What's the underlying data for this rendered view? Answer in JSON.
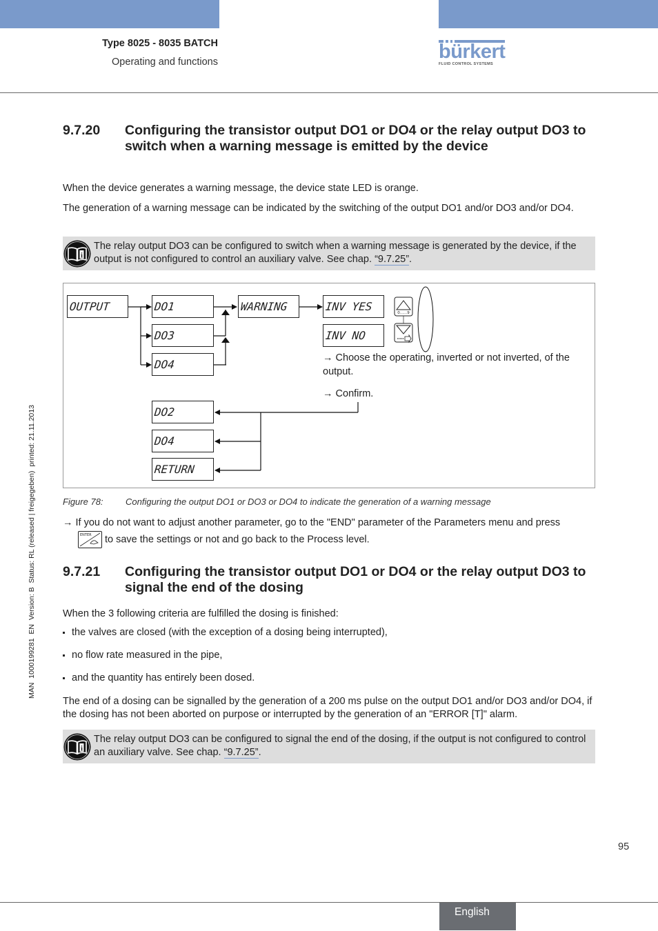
{
  "header": {
    "title": "Type 8025 - 8035 BATCH",
    "subtitle": "Operating and functions",
    "logo": {
      "name": "bürkert",
      "tagline": "FLUID CONTROL SYSTEMS"
    },
    "accent_color": "#7a9acb"
  },
  "sidebar_meta": "MAN  1000199281  EN  Version: B  Status: RL (released | freigegeben)  printed: 21.11.2013",
  "section_9_7_20": {
    "number": "9.7.20",
    "title": "Configuring the transistor output DO1 or DO4 or the relay output DO3 to switch when a warning message is emitted by the device",
    "para1": "When the device generates a warning message, the device state LED is orange.",
    "para2": "The generation of a warning message can be indicated by the switching of the output DO1 and/or DO3 and/or DO4.",
    "note": {
      "icon": "info-book-icon",
      "text_before": "The relay output DO3 can be configured to switch when a warning message is generated by the device, if the output is not configured to control an auxiliary valve. See chap. ",
      "link": "“9.7.25”",
      "text_after": "."
    },
    "figure": {
      "boxes": {
        "output": "OUTPUT",
        "do1": "DO1",
        "do3": "DO3",
        "do4": "DO4",
        "warning": "WARNING",
        "inv_yes": "INV YES",
        "inv_no": "INV NO",
        "do2_back": "DO2",
        "do4_back": "DO4",
        "return": "RETURN"
      },
      "key_up_label": "0......9",
      "note_choose": "→ Choose the operating, inverted or not inverted, of the output.",
      "note_confirm": "→ Confirm."
    },
    "caption": {
      "label": "Figure 78:",
      "text": "Configuring the output DO1 or DO3 or DO4 to indicate the generation of a warning message"
    },
    "instruction": {
      "text_before": "→ If you do not want to adjust another parameter, go to the \"END\" parameter of the Parameters menu and press",
      "key_label": "ENTER",
      "text_after": "to save the settings or not and go back to the Process level."
    }
  },
  "section_9_7_21": {
    "number": "9.7.21",
    "title": "Configuring the transistor output DO1 or DO4 or the relay output DO3 to signal the end of the dosing",
    "intro": "When the 3 following criteria are fulfilled the dosing is finished:",
    "bullets": [
      "the valves are closed (with the exception of a dosing being interrupted),",
      "no flow rate measured in the pipe,",
      "and the quantity has entirely been dosed."
    ],
    "para": "The end of a dosing can be signalled by the generation of a 200 ms pulse on the output DO1 and/or DO3 and/or DO4, if the dosing has not been aborted on purpose or interrupted by the generation of an \"ERROR [T]\" alarm.",
    "note": {
      "icon": "info-book-icon",
      "text_before": "The relay output DO3 can be configured to signal the end of the dosing, if the output is not configured to control an auxiliary valve. See chap. ",
      "link": "“9.7.25”",
      "text_after": "."
    }
  },
  "footer": {
    "page_number": "95",
    "language": "English"
  }
}
